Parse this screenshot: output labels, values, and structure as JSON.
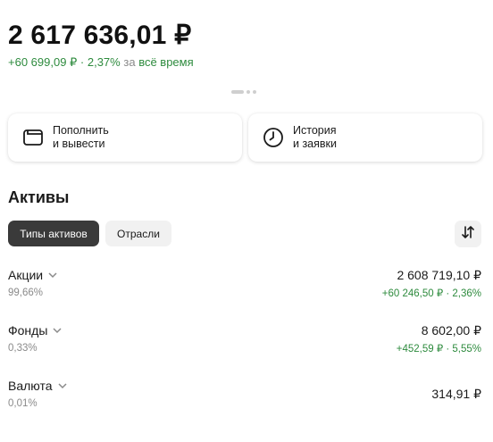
{
  "portfolio": {
    "balance": "2 617 636,01 ₽",
    "change_value": "+60 699,09 ₽ · 2,37%",
    "change_connector": "за",
    "change_period": "всё время"
  },
  "actions": {
    "deposit_line1": "Пополнить",
    "deposit_line2": "и вывести",
    "history_line1": "История",
    "history_line2": "и заявки"
  },
  "assets": {
    "title": "Активы",
    "tabs": [
      {
        "label": "Типы активов",
        "active": true
      },
      {
        "label": "Отрасли",
        "active": false
      }
    ],
    "rows": [
      {
        "name": "Акции",
        "share": "99,66%",
        "value": "2 608 719,10 ₽",
        "delta": "+60 246,50 ₽ · 2,36%"
      },
      {
        "name": "Фонды",
        "share": "0,33%",
        "value": "8 602,00 ₽",
        "delta": "+452,59 ₽ · 5,55%"
      },
      {
        "name": "Валюта",
        "share": "0,01%",
        "value": "314,91 ₽",
        "delta": ""
      }
    ]
  },
  "colors": {
    "positive": "#2e8b3e",
    "chip_active": "#3a3a3a",
    "chip_inactive": "#f1f1f1",
    "muted": "#8a8a8a"
  },
  "icons": {
    "deposit": "wallet-icon",
    "history": "clock-icon",
    "sort": "sort-arrows-icon",
    "expand": "chevron-down-icon"
  }
}
